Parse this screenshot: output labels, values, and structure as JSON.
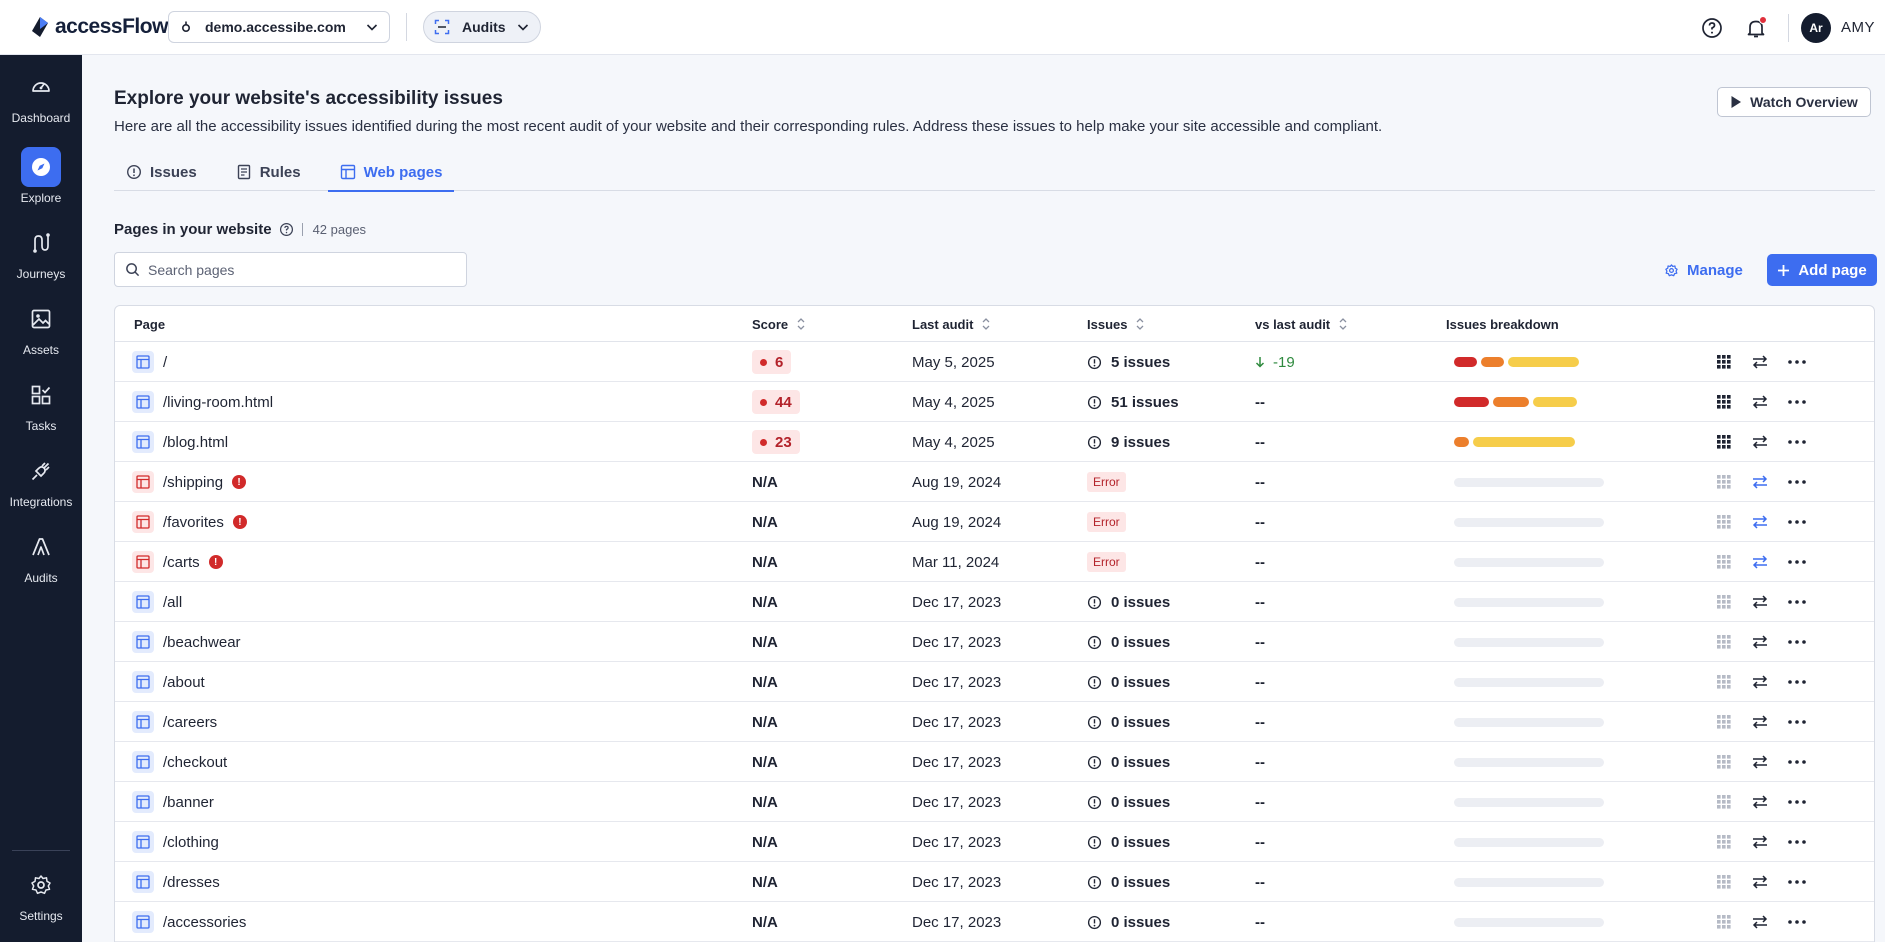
{
  "app": {
    "name": "accessFlow",
    "site": "demo.accessibe.com",
    "product_chip": "Audits",
    "user_initials": "Ar",
    "user_name": "AMY"
  },
  "sidebar": {
    "items": [
      {
        "label": "Dashboard",
        "icon": "gauge-icon"
      },
      {
        "label": "Explore",
        "icon": "compass-icon",
        "active": true
      },
      {
        "label": "Journeys",
        "icon": "journey-icon"
      },
      {
        "label": "Assets",
        "icon": "image-icon"
      },
      {
        "label": "Tasks",
        "icon": "tasks-icon"
      },
      {
        "label": "Integrations",
        "icon": "plug-icon"
      },
      {
        "label": "Audits",
        "icon": "audits-icon"
      }
    ],
    "settings_label": "Settings"
  },
  "header": {
    "title": "Explore your website's accessibility issues",
    "description": "Here are all the accessibility issues identified during the most recent audit of your website and their corresponding rules. Address these issues to help make your site accessible and compliant.",
    "watch_label": "Watch Overview"
  },
  "tabs": [
    {
      "label": "Issues",
      "icon": "info-circle-icon"
    },
    {
      "label": "Rules",
      "icon": "document-icon"
    },
    {
      "label": "Web pages",
      "icon": "layout-icon",
      "active": true
    }
  ],
  "pages_section": {
    "title": "Pages in your website",
    "count": "42 pages",
    "search_placeholder": "Search pages",
    "manage_label": "Manage",
    "add_label": "Add page"
  },
  "table": {
    "columns": {
      "page": "Page",
      "score": "Score",
      "last_audit": "Last audit",
      "issues": "Issues",
      "vs_last": "vs last audit",
      "breakdown": "Issues breakdown"
    },
    "rows": [
      {
        "page": "/",
        "error": false,
        "score": "6",
        "last_audit": "May 5, 2025",
        "issues": "5 issues",
        "vs": "-19",
        "breakdown": [
          0.15,
          0.15,
          0.47
        ]
      },
      {
        "page": "/living-room.html",
        "error": false,
        "score": "44",
        "last_audit": "May 4, 2025",
        "issues": "51 issues",
        "vs": "--",
        "breakdown": [
          0.23,
          0.24,
          0.29
        ]
      },
      {
        "page": "/blog.html",
        "error": false,
        "score": "23",
        "last_audit": "May 4, 2025",
        "issues": "9 issues",
        "vs": "--",
        "breakdown": [
          0,
          0.1,
          0.68
        ]
      },
      {
        "page": "/shipping",
        "error": true,
        "score": "N/A",
        "last_audit": "Aug 19, 2024",
        "issues": "Error",
        "vs": "--",
        "breakdown": null
      },
      {
        "page": "/favorites",
        "error": true,
        "score": "N/A",
        "last_audit": "Aug 19, 2024",
        "issues": "Error",
        "vs": "--",
        "breakdown": null
      },
      {
        "page": "/carts",
        "error": true,
        "score": "N/A",
        "last_audit": "Mar 11, 2024",
        "issues": "Error",
        "vs": "--",
        "breakdown": null
      },
      {
        "page": "/all",
        "error": false,
        "score": "N/A",
        "last_audit": "Dec 17, 2023",
        "issues": "0 issues",
        "vs": "--",
        "breakdown": null
      },
      {
        "page": "/beachwear",
        "error": false,
        "score": "N/A",
        "last_audit": "Dec 17, 2023",
        "issues": "0 issues",
        "vs": "--",
        "breakdown": null
      },
      {
        "page": "/about",
        "error": false,
        "score": "N/A",
        "last_audit": "Dec 17, 2023",
        "issues": "0 issues",
        "vs": "--",
        "breakdown": null
      },
      {
        "page": "/careers",
        "error": false,
        "score": "N/A",
        "last_audit": "Dec 17, 2023",
        "issues": "0 issues",
        "vs": "--",
        "breakdown": null
      },
      {
        "page": "/checkout",
        "error": false,
        "score": "N/A",
        "last_audit": "Dec 17, 2023",
        "issues": "0 issues",
        "vs": "--",
        "breakdown": null
      },
      {
        "page": "/banner",
        "error": false,
        "score": "N/A",
        "last_audit": "Dec 17, 2023",
        "issues": "0 issues",
        "vs": "--",
        "breakdown": null
      },
      {
        "page": "/clothing",
        "error": false,
        "score": "N/A",
        "last_audit": "Dec 17, 2023",
        "issues": "0 issues",
        "vs": "--",
        "breakdown": null
      },
      {
        "page": "/dresses",
        "error": false,
        "score": "N/A",
        "last_audit": "Dec 17, 2023",
        "issues": "0 issues",
        "vs": "--",
        "breakdown": null
      },
      {
        "page": "/accessories",
        "error": false,
        "score": "N/A",
        "last_audit": "Dec 17, 2023",
        "issues": "0 issues",
        "vs": "--",
        "breakdown": null
      }
    ]
  },
  "colors": {
    "accent": "#3d6df0",
    "sidebar": "#141c2e",
    "critical": "#d12a2a",
    "high": "#ec7f2c",
    "medium": "#f6cd4a",
    "positive": "#2e8a3e"
  }
}
